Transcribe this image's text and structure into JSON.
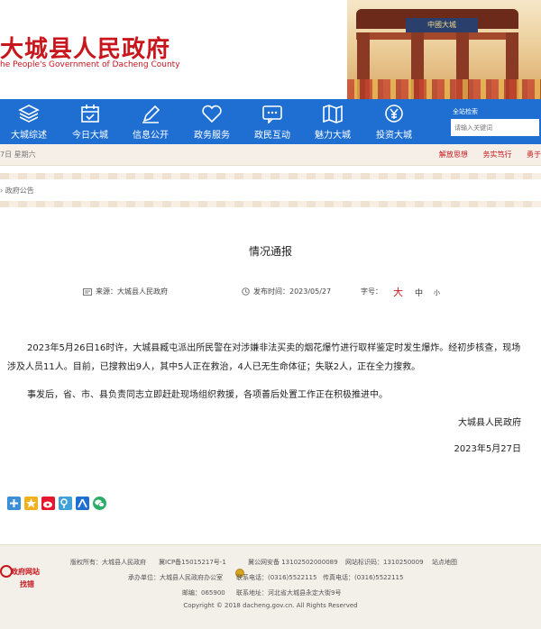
{
  "header": {
    "title_cn": "大城县人民政府",
    "title_en": "he People's Government of Dacheng County",
    "gate_plaque": "中國大城"
  },
  "nav": {
    "items": [
      {
        "label": "大城综述",
        "icon": "layers-icon"
      },
      {
        "label": "今日大城",
        "icon": "calendar-icon"
      },
      {
        "label": "信息公开",
        "icon": "pen-icon"
      },
      {
        "label": "政务服务",
        "icon": "heart-icon"
      },
      {
        "label": "政民互动",
        "icon": "chat-icon"
      },
      {
        "label": "魅力大城",
        "icon": "map-icon"
      },
      {
        "label": "投资大城",
        "icon": "yen-icon"
      }
    ],
    "search_title": "全站检索",
    "search_placeholder": "请输入关键词"
  },
  "datebar": {
    "date": "7日 星期六",
    "links": [
      "解放思想",
      "务实笃行",
      "勇于"
    ]
  },
  "breadcrumb": "政府公告",
  "article": {
    "title": "情况通报",
    "source_label": "来源：",
    "source": "大城县人民政府",
    "time_label": "发布时间：",
    "time": "2023/05/27",
    "fontsize_label": "字号：",
    "fs_large": "大",
    "fs_mid": "中",
    "fs_small": "小",
    "paragraphs": [
      "2023年5月26日16时许，大城县臧屯派出所民警在对涉嫌非法买卖的烟花爆竹进行取样鉴定时发生爆炸。经初步核查，现场涉及人员11人。目前，已搜救出9人，其中5人正在救治，4人已无生命体征；失联2人，正在全力搜救。",
      "事发后，省、市、县负责同志立即赶赴现场组织救援，各项善后处置工作正在积极推进中。"
    ],
    "signature": "大城县人民政府",
    "sign_date": "2023年5月27日"
  },
  "share": {
    "icons": [
      {
        "name": "share-plus-icon",
        "color": "#3b8fd9"
      },
      {
        "name": "share-qzone-icon",
        "color": "#f2b01e"
      },
      {
        "name": "share-weibo-icon",
        "color": "#e6162d"
      },
      {
        "name": "share-tencent-icon",
        "color": "#3ea2d8"
      },
      {
        "name": "share-renren-icon",
        "color": "#1f6fd3"
      },
      {
        "name": "share-wechat-icon",
        "color": "#2aae67"
      }
    ]
  },
  "footer": {
    "badge_line1": "政府网站",
    "badge_line2": "找错",
    "row1": {
      "owner": "版权所有：大城县人民政府",
      "icp": "冀ICP备15015217号-1",
      "police": "冀公网安备 13102502000089",
      "site_id": "网站标识码：1310250009",
      "sitemap": "站点地图"
    },
    "row2": {
      "host": "承办单位：大城县人民政府办公室",
      "phone": "联系电话：(0316)5522115",
      "fax": "传真电话：(0316)5522115"
    },
    "row3": {
      "zip": "邮编：065900",
      "address": "联系地址：河北省大城县永定大街9号"
    },
    "copyright": "Copyright © 2018 dacheng.gov.cn. All Rights Reserved"
  },
  "colors": {
    "brand_red": "#c8161d",
    "nav_blue": "#1f6fd3"
  }
}
